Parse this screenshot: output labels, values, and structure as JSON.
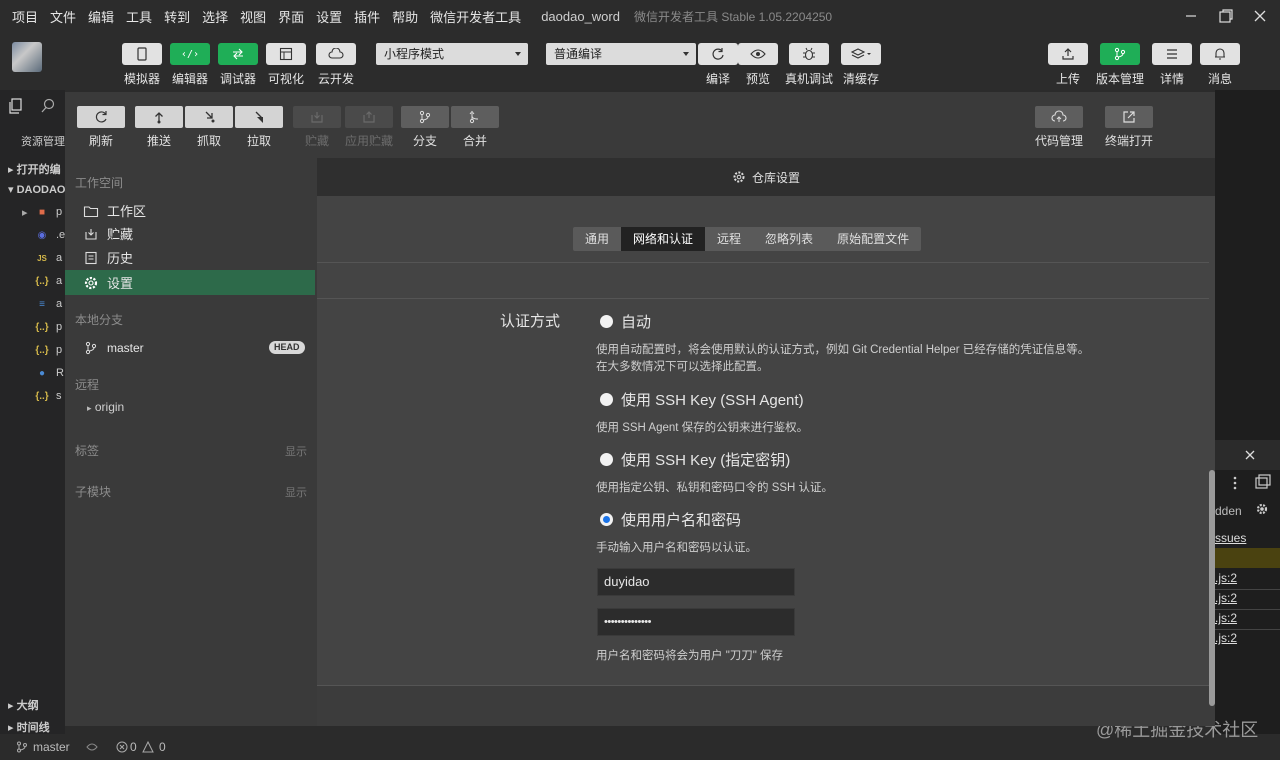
{
  "menubar": {
    "items": [
      "项目",
      "文件",
      "编辑",
      "工具",
      "转到",
      "选择",
      "视图",
      "界面",
      "设置",
      "插件",
      "帮助",
      "微信开发者工具"
    ],
    "project_name": "daodao_word",
    "app_title": "微信开发者工具 Stable 1.05.2204250"
  },
  "toolbar": {
    "simulator": "模拟器",
    "editor": "编辑器",
    "debugger": "调试器",
    "visualize": "可视化",
    "cloud": "云开发",
    "mode_select": "小程序模式",
    "compile_select": "普通编译",
    "compile": "编译",
    "preview": "预览",
    "device_debug": "真机调试",
    "clear_cache": "清缓存",
    "upload": "上传",
    "version_mgmt": "版本管理",
    "details": "详情",
    "messages": "消息"
  },
  "background_ide": {
    "explorer_label": "资源管理",
    "open_editors": "打开的编",
    "project_root": "DAODAO",
    "outline": "大纲",
    "timeline": "时间线",
    "tree_items": [
      "p",
      ".e",
      "a",
      "a",
      "a",
      "p",
      "p",
      "R",
      "s"
    ]
  },
  "right_panel": {
    "hidden_label": "dden",
    "issues_label": "ssues",
    "log_links": [
      ".js:2",
      ".js:2",
      ".js:2",
      ".js:2"
    ]
  },
  "statusbar": {
    "branch": "master",
    "errors": "0",
    "warnings": "0",
    "watermark": "@稀土掘金技术社区"
  },
  "vc_dialog": {
    "toolbar": {
      "refresh": "刷新",
      "push": "推送",
      "fetch": "抓取",
      "pull": "拉取",
      "stash": "贮藏",
      "apply_stash": "应用贮藏",
      "branch": "分支",
      "merge": "合并",
      "code_mgmt": "代码管理",
      "open_terminal": "终端打开"
    },
    "sidebar": {
      "workspace_header": "工作空间",
      "workspace_items": [
        {
          "label": "工作区"
        },
        {
          "label": "贮藏"
        },
        {
          "label": "历史"
        },
        {
          "label": "设置"
        }
      ],
      "local_branch_header": "本地分支",
      "local_branch": "master",
      "head_badge": "HEAD",
      "remote_header": "远程",
      "remote_origin": "origin",
      "tags_header": "标签",
      "tags_show": "显示",
      "submodules_header": "子模块",
      "submodules_show": "显示"
    },
    "main": {
      "title": "仓库设置",
      "tabs": [
        "通用",
        "网络和认证",
        "远程",
        "忽略列表",
        "原始配置文件"
      ],
      "active_tab": "网络和认证",
      "auth_label": "认证方式",
      "options": [
        {
          "label": "自动",
          "checked": false,
          "desc": "使用自动配置时，将会使用默认的认证方式，例如 Git Credential Helper 已经存储的凭证信息等。在大多数情况下可以选择此配置。"
        },
        {
          "label": "使用 SSH Key (SSH Agent)",
          "checked": false,
          "desc": "使用 SSH Agent 保存的公钥来进行鉴权。"
        },
        {
          "label": "使用 SSH Key (指定密钥)",
          "checked": false,
          "desc": "使用指定公钥、私钥和密码口令的 SSH 认证。"
        },
        {
          "label": "使用用户名和密码",
          "checked": true,
          "desc": "手动输入用户名和密码以认证。"
        }
      ],
      "username": "duyidao",
      "password": "••••••••••••••",
      "save_note": "用户名和密码将会为用户 \"刀刀\" 保存"
    }
  }
}
